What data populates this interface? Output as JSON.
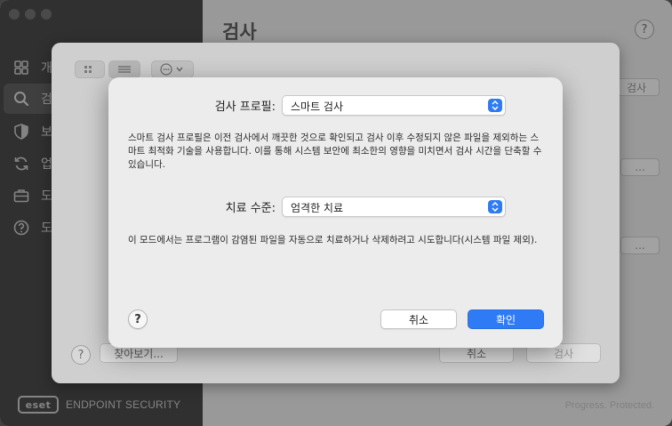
{
  "sidebar": {
    "items": [
      {
        "label": "개",
        "icon": "grid-icon"
      },
      {
        "label": "검",
        "icon": "search-icon"
      },
      {
        "label": "보",
        "icon": "shield-icon"
      },
      {
        "label": "업",
        "icon": "refresh-icon"
      },
      {
        "label": "도",
        "icon": "toolbox-icon"
      },
      {
        "label": "도",
        "icon": "help-icon"
      }
    ],
    "active_index": 1,
    "brand_logo": "eset",
    "brand_name": "ENDPOINT SECURITY"
  },
  "main": {
    "title": "검사",
    "help_label": "?",
    "partial_button_1": "검사",
    "partial_button_2": "...",
    "partial_button_3": "...",
    "tagline": "Progress. Protected."
  },
  "scan_sheet": {
    "view_toggle_icons": [
      "grid-view-icon",
      "list-view-icon"
    ],
    "more_menu_icon": "ellipsis-circle-icon",
    "help_label": "?",
    "browse_button": "찾아보기...",
    "cancel_button": "취소",
    "scan_button": "검사"
  },
  "dialog": {
    "profile_label": "검사 프로필:",
    "profile_value": "스마트 검사",
    "profile_description": "스마트 검사 프로필은 이전 검사에서 깨끗한 것으로 확인되고 검사 이후 수정되지 않은 파일을 제외하는 스마트 최적화 기술을 사용합니다. 이를 통해 시스템 보안에 최소한의 영향을 미치면서 검사 시간을 단축할 수 있습니다.",
    "cleaning_label": "치료 수준:",
    "cleaning_value": "엄격한 치료",
    "cleaning_description": "이 모드에서는 프로그램이 감염된 파일을 자동으로 치료하거나 삭제하려고 시도합니다(시스템 파일 제외).",
    "help_label": "?",
    "cancel_button": "취소",
    "ok_button": "확인"
  },
  "colors": {
    "accent": "#2f7bf5",
    "sidebar_bg": "#454545",
    "dialog_bg": "#ececec"
  }
}
